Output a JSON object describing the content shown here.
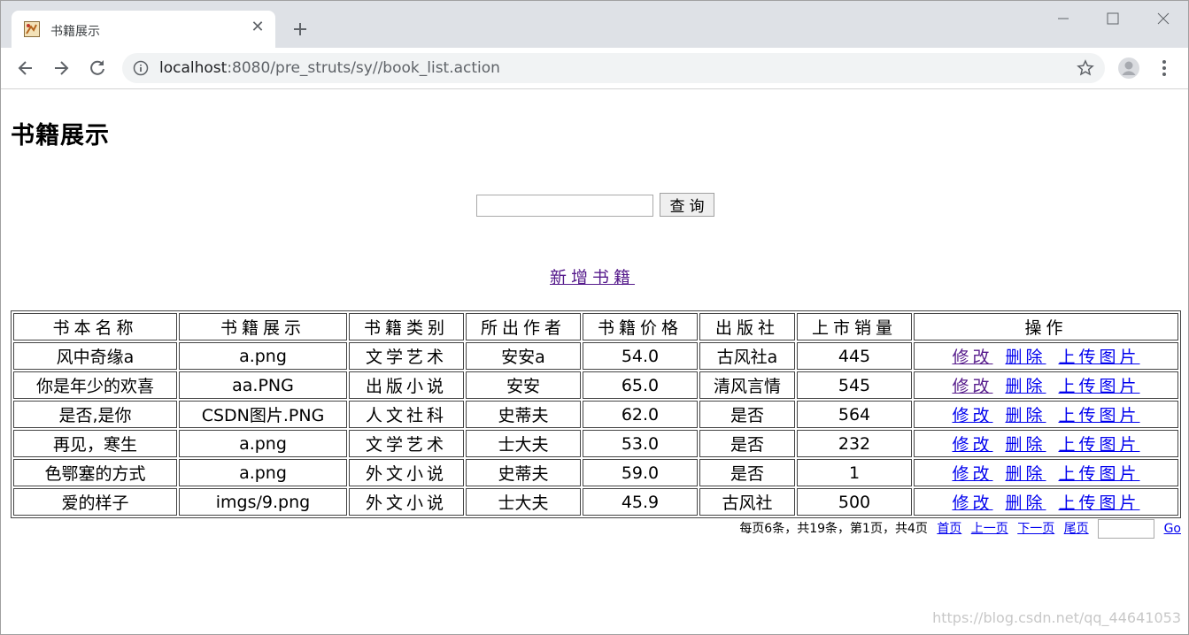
{
  "browser": {
    "tab_title": "书籍展示",
    "url_host": "localhost",
    "url_rest": ":8080/pre_struts/sy//book_list.action"
  },
  "page": {
    "heading": "书籍展示",
    "search": {
      "value": "",
      "button_label": "查询"
    },
    "add_link": "新增书籍"
  },
  "table": {
    "headers": [
      "书本名称",
      "书籍展示",
      "书籍类别",
      "所出作者",
      "书籍价格",
      "出版社",
      "上市销量",
      "操作"
    ],
    "rows": [
      [
        "风中奇缘a",
        "a.png",
        "文学艺术",
        "安安a",
        "54.0",
        "古风社a",
        "445"
      ],
      [
        "你是年少的欢喜",
        "aa.PNG",
        "出版小说",
        "安安",
        "65.0",
        "清风言情",
        "545"
      ],
      [
        "是否,是你",
        "CSDN图片.PNG",
        "人文社科",
        "史蒂夫",
        "62.0",
        "是否",
        "564"
      ],
      [
        "再见，寒生",
        "a.png",
        "文学艺术",
        "士大夫",
        "53.0",
        "是否",
        "232"
      ],
      [
        "色鄂塞的方式",
        "a.png",
        "外文小说",
        "史蒂夫",
        "59.0",
        "是否",
        "1"
      ],
      [
        "爱的样子",
        "imgs/9.png",
        "外文小说",
        "士大夫",
        "45.9",
        "古风社",
        "500"
      ]
    ],
    "actions": [
      "修改",
      "删除",
      "上传图片"
    ]
  },
  "pager": {
    "summary": "每页6条，共19条，第1页，共4页",
    "first": "首页",
    "prev": "上一页",
    "next": "下一页",
    "last": "尾页",
    "go": "Go"
  },
  "watermark": "https://blog.csdn.net/qq_44641053"
}
